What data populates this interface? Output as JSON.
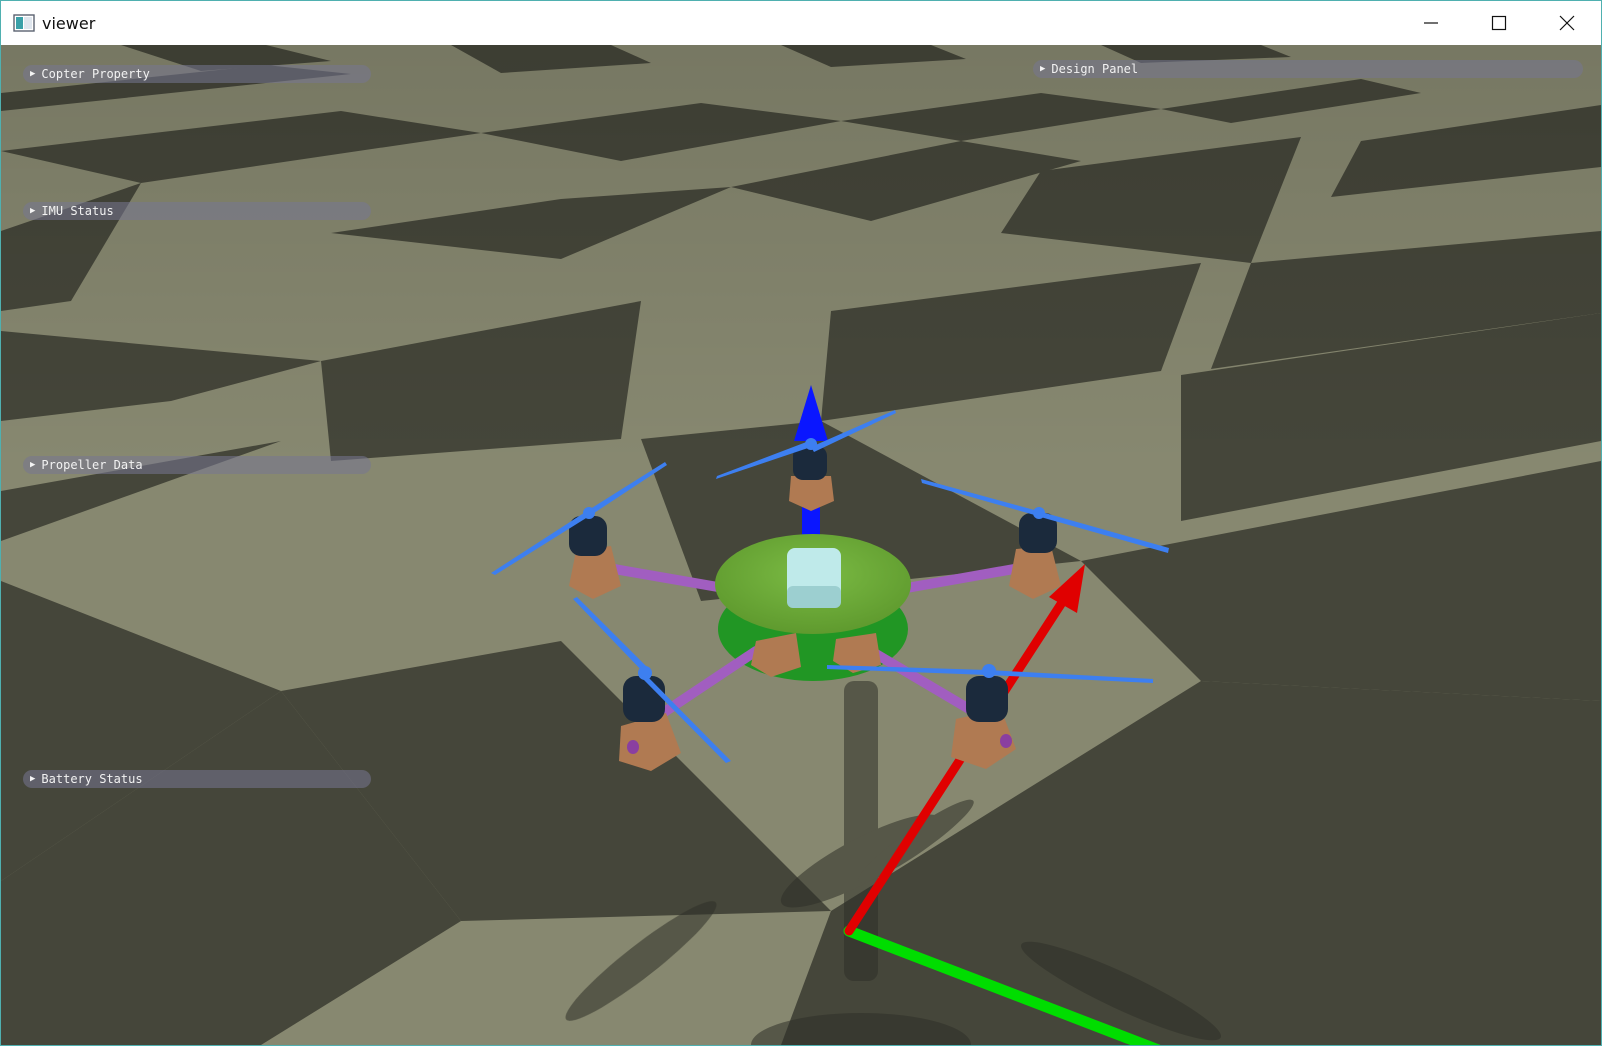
{
  "window": {
    "title": "viewer",
    "icons": {
      "app": "app-window-icon",
      "minimize": "minimize-icon",
      "maximize": "maximize-icon",
      "close": "close-icon"
    }
  },
  "panels": [
    {
      "id": "copter-property",
      "label": "Copter Property",
      "expanded": false
    },
    {
      "id": "imu-status",
      "label": "IMU Status",
      "expanded": false
    },
    {
      "id": "propeller-data",
      "label": "Propeller Data",
      "expanded": false
    },
    {
      "id": "battery-status",
      "label": "Battery Status",
      "expanded": false
    },
    {
      "id": "design-panel",
      "label": "Design Panel",
      "expanded": false
    }
  ],
  "panel_arrow": "▶",
  "scene": {
    "floor_colors": {
      "light": "#878870",
      "dark": "#45463a"
    },
    "axis_colors": {
      "x": "#e00000",
      "y": "#00dd00",
      "z": "#0a16ff"
    },
    "copter": {
      "rotors": 5,
      "body_color": "#6fae3a",
      "arm_color": "#a15ec0",
      "motor_color": "#1b2a3c",
      "mount_color": "#b07a52",
      "propeller_color": "#3d7ff0",
      "payload_color": "#bfeaea"
    }
  }
}
